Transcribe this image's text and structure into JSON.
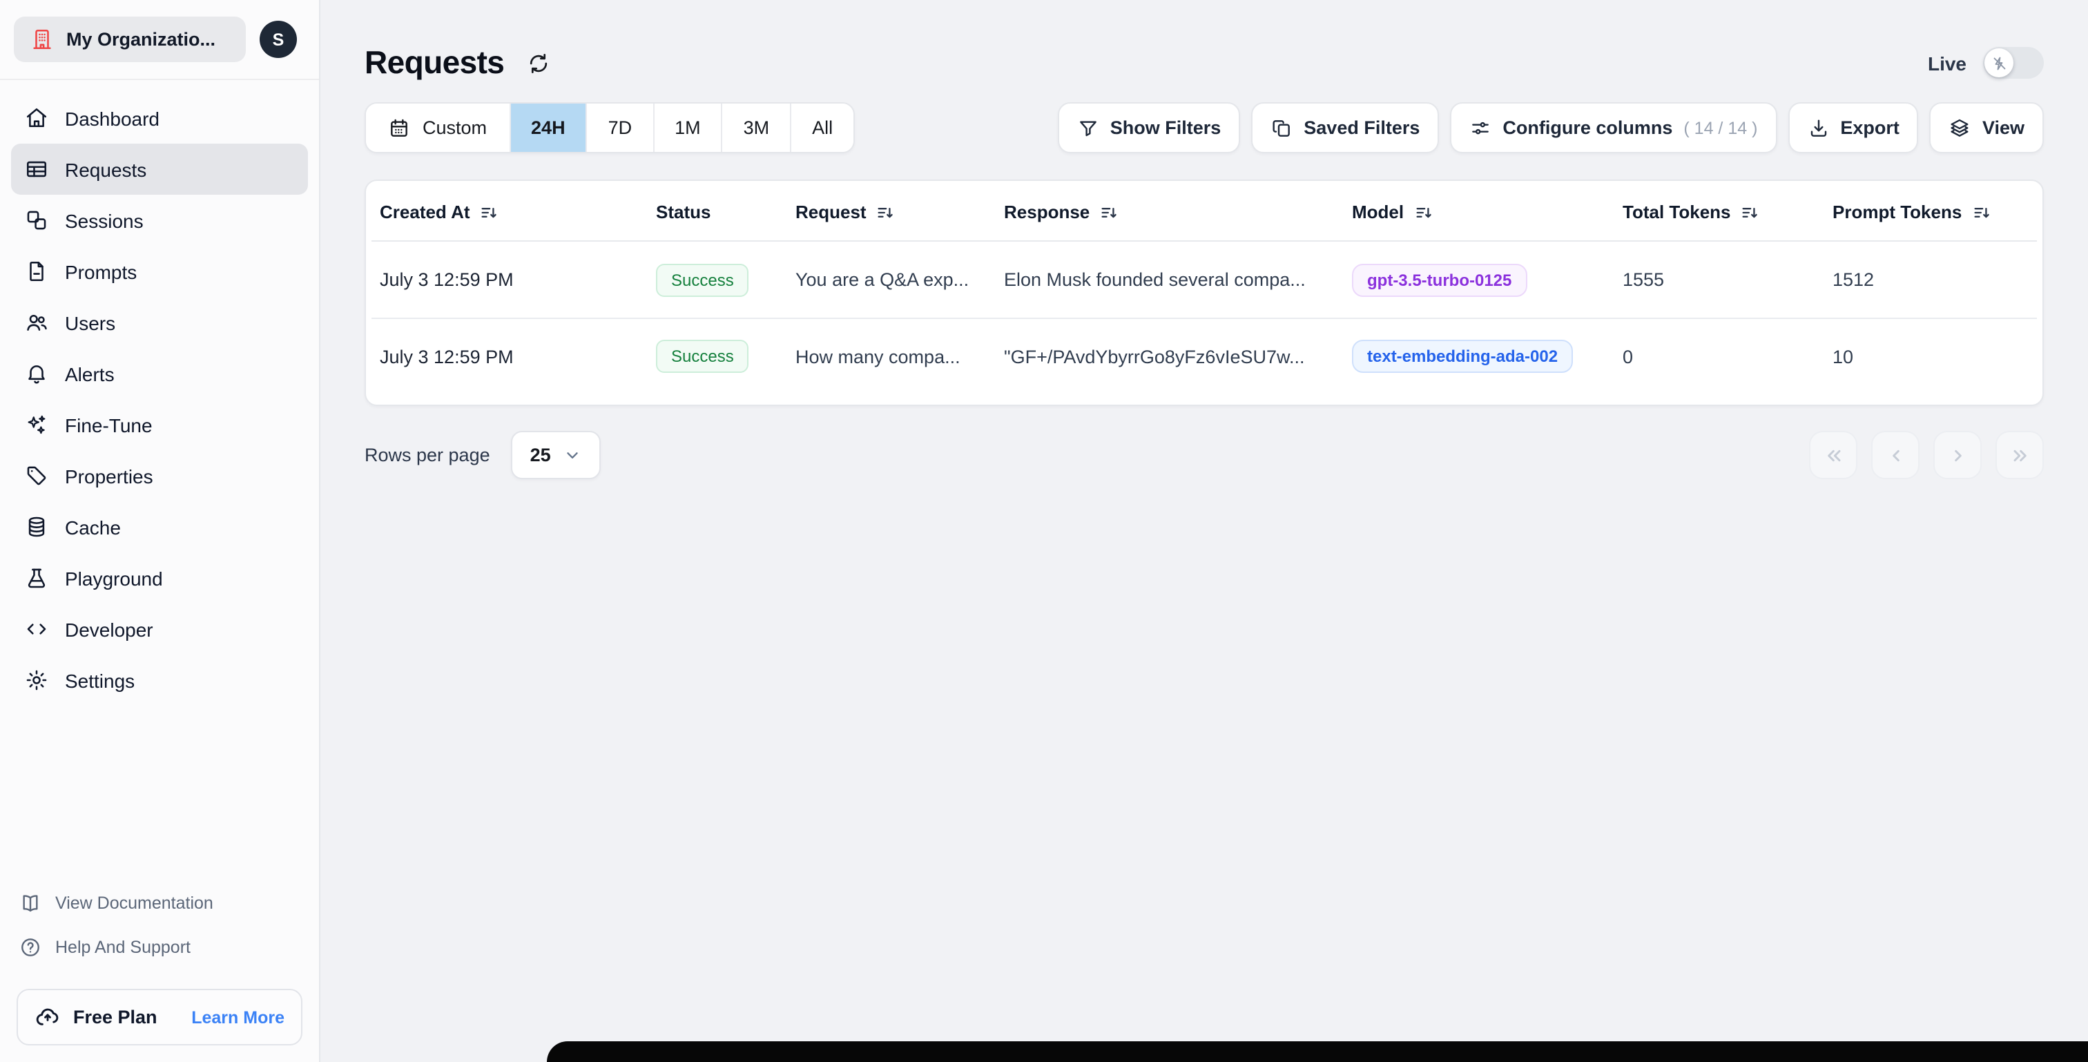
{
  "colors": {
    "accent_blue_segment": "#b5d9f3",
    "success_green": "#15803d",
    "model_purple": "#8b31dd",
    "model_blue": "#2563eb",
    "org_icon_red": "#ef4444",
    "learn_more_blue": "#3b82f6"
  },
  "sidebar": {
    "org": {
      "name": "My Organizatio...",
      "avatar_initial": "S",
      "icon": "building-icon"
    },
    "items": [
      {
        "label": "Dashboard",
        "icon": "home-icon",
        "active": false
      },
      {
        "label": "Requests",
        "icon": "table-icon",
        "active": true
      },
      {
        "label": "Sessions",
        "icon": "sessions-icon",
        "active": false
      },
      {
        "label": "Prompts",
        "icon": "document-icon",
        "active": false
      },
      {
        "label": "Users",
        "icon": "users-icon",
        "active": false
      },
      {
        "label": "Alerts",
        "icon": "bell-icon",
        "active": false
      },
      {
        "label": "Fine-Tune",
        "icon": "sparkles-icon",
        "active": false
      },
      {
        "label": "Properties",
        "icon": "tag-icon",
        "active": false
      },
      {
        "label": "Cache",
        "icon": "database-icon",
        "active": false
      },
      {
        "label": "Playground",
        "icon": "flask-icon",
        "active": false
      },
      {
        "label": "Developer",
        "icon": "code-icon",
        "active": false
      },
      {
        "label": "Settings",
        "icon": "gear-icon",
        "active": false
      }
    ],
    "footer_links": [
      {
        "label": "View Documentation",
        "icon": "book-icon"
      },
      {
        "label": "Help And Support",
        "icon": "question-icon"
      }
    ],
    "plan": {
      "label": "Free Plan",
      "action": "Learn More",
      "icon": "cloud-upload-icon"
    }
  },
  "header": {
    "title": "Requests",
    "live_label": "Live",
    "live_on": false
  },
  "toolbar": {
    "time_ranges": [
      {
        "label": "Custom",
        "active": false,
        "icon": "calendar-icon"
      },
      {
        "label": "24H",
        "active": true
      },
      {
        "label": "7D",
        "active": false
      },
      {
        "label": "1M",
        "active": false
      },
      {
        "label": "3M",
        "active": false
      },
      {
        "label": "All",
        "active": false
      }
    ],
    "actions": {
      "show_filters": "Show Filters",
      "saved_filters": "Saved Filters",
      "configure_columns": "Configure columns",
      "configure_columns_count": "( 14 / 14 )",
      "export": "Export",
      "view": "View"
    }
  },
  "table": {
    "columns": [
      {
        "label": "Created At",
        "sortable": true
      },
      {
        "label": "Status",
        "sortable": false
      },
      {
        "label": "Request",
        "sortable": true
      },
      {
        "label": "Response",
        "sortable": true
      },
      {
        "label": "Model",
        "sortable": true
      },
      {
        "label": "Total Tokens",
        "sortable": true
      },
      {
        "label": "Prompt Tokens",
        "sortable": true
      }
    ],
    "rows": [
      {
        "created_at": "July 3 12:59 PM",
        "status": "Success",
        "request": "You are a Q&A exp...",
        "response": "Elon Musk founded several compa...",
        "model": "gpt-3.5-turbo-0125",
        "model_color": "purple",
        "total_tokens": "1555",
        "prompt_tokens": "1512"
      },
      {
        "created_at": "July 3 12:59 PM",
        "status": "Success",
        "request": "How many compa...",
        "response": "\"GF+/PAvdYbyrrGo8yFz6vIeSU7w...",
        "model": "text-embedding-ada-002",
        "model_color": "blue",
        "total_tokens": "0",
        "prompt_tokens": "10"
      }
    ]
  },
  "pagination": {
    "rows_per_page_label": "Rows per page",
    "rows_per_page_value": "25"
  }
}
